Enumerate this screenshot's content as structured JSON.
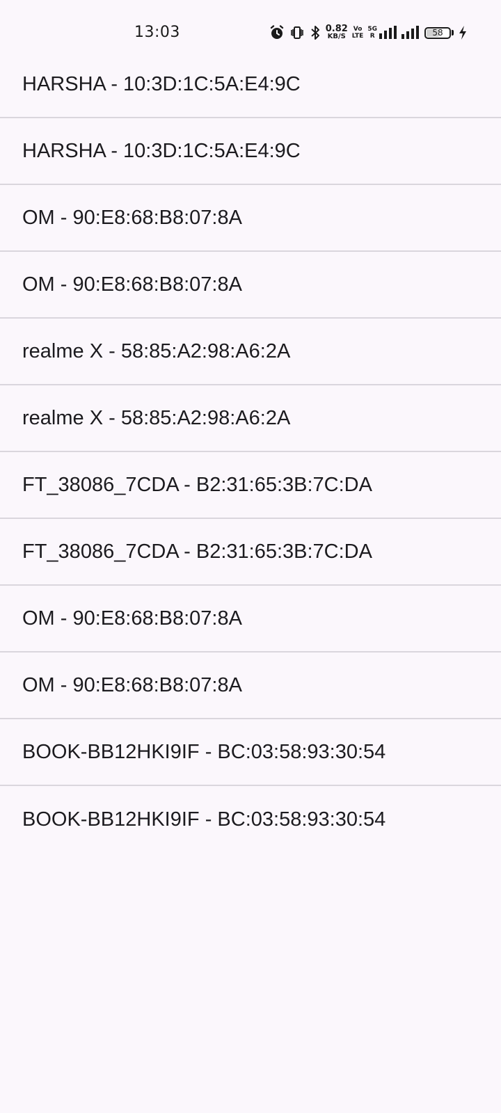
{
  "status_bar": {
    "time": "13:03",
    "net_speed_value": "0.82",
    "net_speed_unit": "KB/S",
    "volte_top": "Vo",
    "volte_bottom": "LTE",
    "network_top": "5G",
    "network_bottom": "R",
    "battery_level": "58",
    "battery_fraction": 0.58,
    "icons": [
      "alarm-icon",
      "vibrate-icon",
      "bluetooth-icon",
      "signal-icon",
      "signal-icon",
      "battery-icon",
      "charging-icon"
    ]
  },
  "devices": [
    {
      "label": "HARSHA - 10:3D:1C:5A:E4:9C"
    },
    {
      "label": "HARSHA - 10:3D:1C:5A:E4:9C"
    },
    {
      "label": "OM - 90:E8:68:B8:07:8A"
    },
    {
      "label": "OM - 90:E8:68:B8:07:8A"
    },
    {
      "label": "realme X - 58:85:A2:98:A6:2A"
    },
    {
      "label": "realme X - 58:85:A2:98:A6:2A"
    },
    {
      "label": "FT_38086_7CDA - B2:31:65:3B:7C:DA"
    },
    {
      "label": "FT_38086_7CDA - B2:31:65:3B:7C:DA"
    },
    {
      "label": "OM - 90:E8:68:B8:07:8A"
    },
    {
      "label": "OM - 90:E8:68:B8:07:8A"
    },
    {
      "label": "BOOK-BB12HKI9IF - BC:03:58:93:30:54"
    },
    {
      "label": "BOOK-BB12HKI9IF - BC:03:58:93:30:54"
    }
  ],
  "colors": {
    "background": "#FBF7FC",
    "text": "#1C1B1F",
    "divider": "#DAD6DD"
  }
}
